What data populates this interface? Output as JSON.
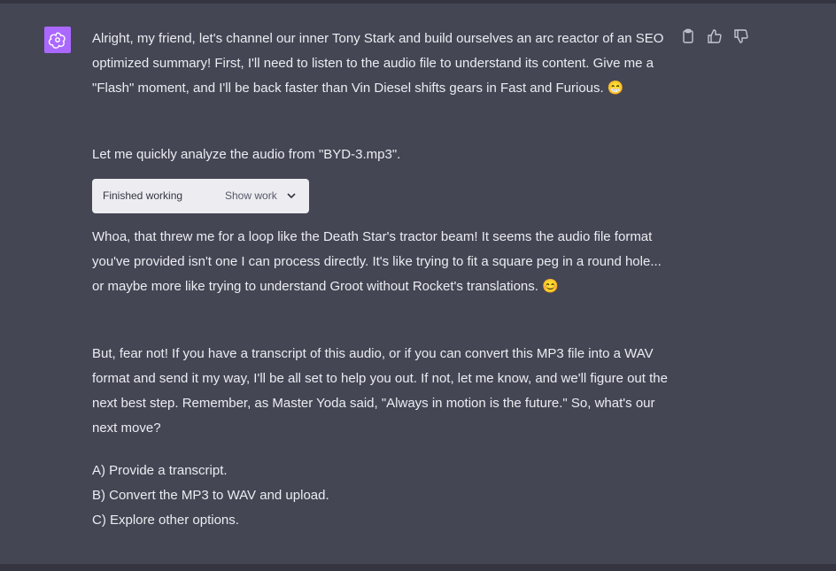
{
  "message": {
    "p1": "Alright, my friend, let's channel our inner Tony Stark and build ourselves an arc reactor of an SEO optimized summary! First, I'll need to listen to the audio file to understand its content. Give me a \"Flash\" moment, and I'll be back faster than Vin Diesel shifts gears in Fast and Furious. 😁",
    "p2": "Let me quickly analyze the audio from \"BYD-3.mp3\".",
    "p3": "Whoa, that threw me for a loop like the Death Star's tractor beam! It seems the audio file format you've provided isn't one I can process directly. It's like trying to fit a square peg in a round hole... or maybe more like trying to understand Groot without Rocket's translations. 😊",
    "p4": "But, fear not! If you have a transcript of this audio, or if you can convert this MP3 file into a WAV format and send it my way, I'll be all set to help you out. If not, let me know, and we'll figure out the next best step. Remember, as Master Yoda said, \"Always in motion is the future.\" So, what's our next move?",
    "options": [
      "A) Provide a transcript.",
      "B) Convert the MP3 to WAV and upload.",
      "C) Explore other options."
    ]
  },
  "work_box": {
    "status": "Finished working",
    "toggle_label": "Show work"
  },
  "icons": {
    "avatar": "openai-logo-icon",
    "copy": "clipboard-icon",
    "like": "thumbs-up-icon",
    "dislike": "thumbs-down-icon",
    "toggle": "chevron-down-icon"
  },
  "colors": {
    "background": "#444654",
    "avatar": "#ab68ff",
    "text": "#ececf1",
    "work_box": "#ececf1"
  }
}
